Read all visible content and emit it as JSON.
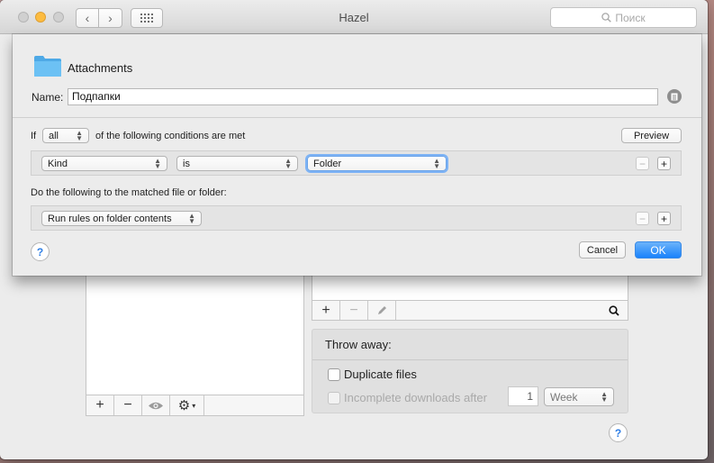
{
  "window": {
    "title": "Hazel",
    "search_placeholder": "Поиск",
    "nav_back": "‹",
    "nav_forward": "›",
    "grid_icon": "grid-icon"
  },
  "background": {
    "throw_away": {
      "heading": "Throw away:",
      "duplicate_files": "Duplicate files",
      "incomplete_downloads": "Incomplete downloads after",
      "incomplete_value": "1",
      "incomplete_unit": "Week"
    },
    "folders_toolbar": {
      "add": "+",
      "remove": "−"
    },
    "rules_toolbar": {
      "add": "+",
      "remove": "−"
    }
  },
  "sheet": {
    "folder_name": "Attachments",
    "name_label": "Name:",
    "name_value": "Подпапки",
    "if_label": "If",
    "match_mode": "all",
    "conditions_text": "of the following conditions are met",
    "preview_button": "Preview",
    "condition": {
      "attribute": "Kind",
      "operator": "is",
      "value": "Folder"
    },
    "actions_label": "Do the following to the matched file or folder:",
    "action": {
      "type": "Run rules on folder contents"
    },
    "row_remove": "−",
    "row_add": "+",
    "help": "?",
    "cancel_button": "Cancel",
    "ok_button": "OK"
  },
  "colors": {
    "accent": "#1a82fb",
    "minimize": "#fdbc40",
    "folder": "#5cb6f0"
  }
}
